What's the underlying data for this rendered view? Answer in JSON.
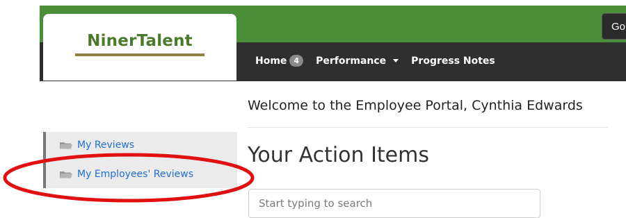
{
  "brand": {
    "logo_text": "NinerTalent",
    "logo_color": "#4a7a2a",
    "underline_color": "#8f8045"
  },
  "header": {
    "green_color": "#4b8f3a",
    "dark_color": "#2f2f2f",
    "go_label": "Go"
  },
  "nav": {
    "items": [
      {
        "label": "Home",
        "badge": "4"
      },
      {
        "label": "Performance",
        "has_dropdown": true
      },
      {
        "label": "Progress Notes"
      }
    ]
  },
  "welcome_text": "Welcome to the Employee Portal, Cynthia Edwards",
  "sidebar": {
    "items": [
      {
        "label": "My Reviews",
        "icon": "folder-icon"
      },
      {
        "label": "My Employees' Reviews",
        "icon": "folder-icon"
      }
    ]
  },
  "main": {
    "title": "Your Action Items",
    "search_placeholder": "Start typing to search"
  },
  "annotation": {
    "shape": "ellipse",
    "color": "#e01010",
    "target": "My Employees' Reviews"
  }
}
